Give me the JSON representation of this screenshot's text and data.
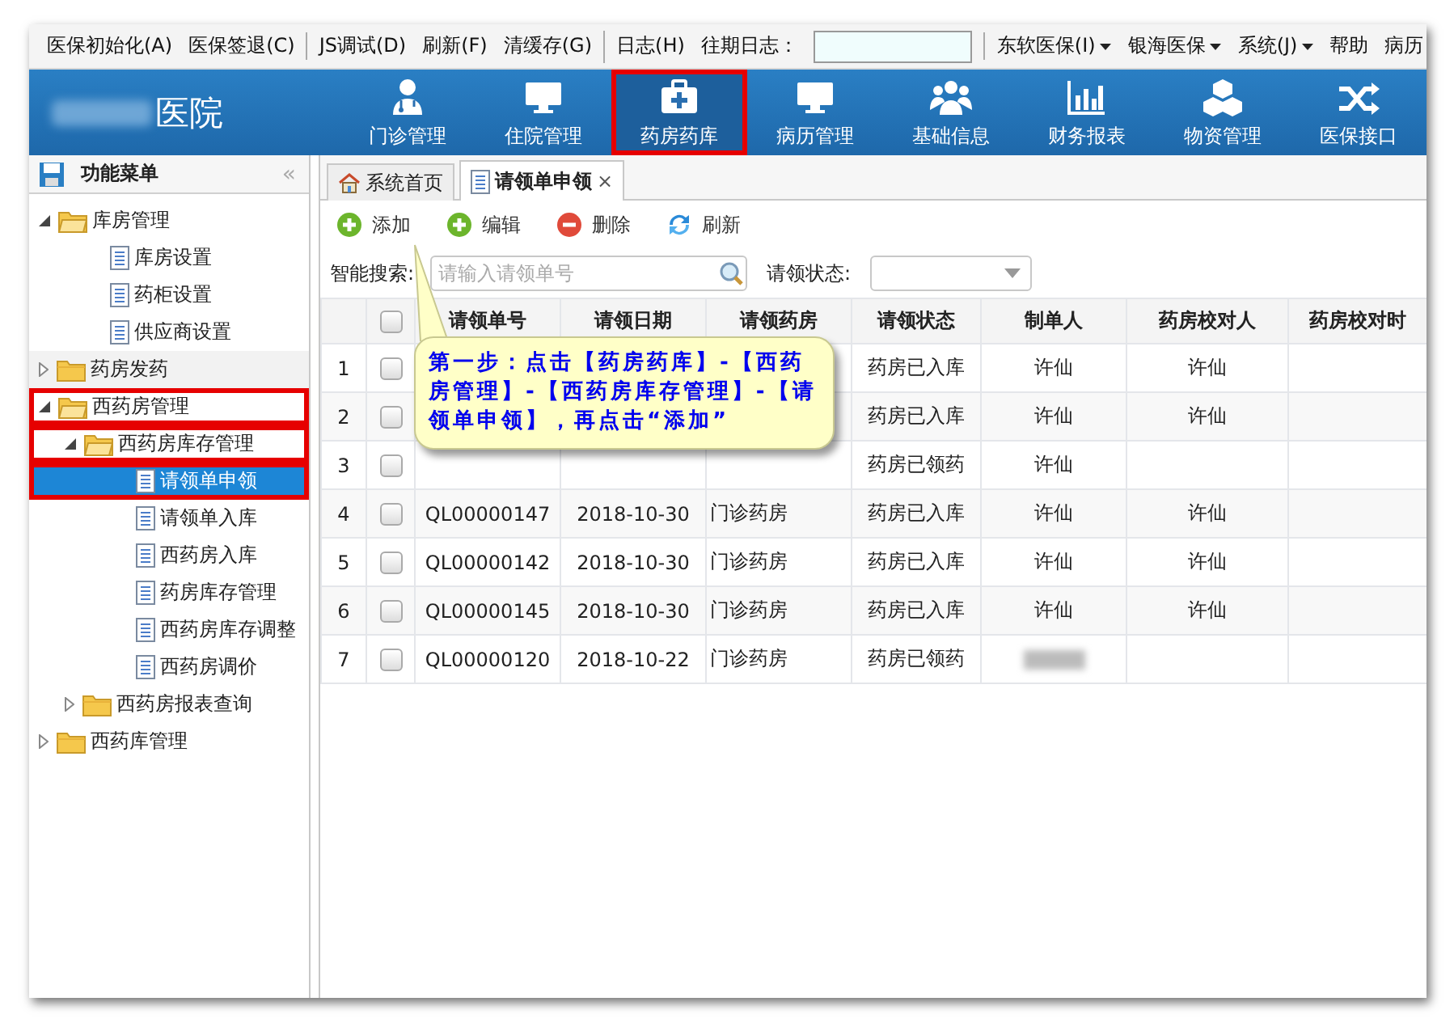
{
  "menu_bar": {
    "groups": [
      [
        {
          "label": "医保初始化(A)"
        },
        {
          "label": "医保签退(C)"
        }
      ],
      [
        {
          "label": "JS调试(D)"
        },
        {
          "label": "刷新(F)"
        },
        {
          "label": "清缓存(G)"
        }
      ],
      [
        {
          "label": "日志(H)"
        },
        {
          "label": "往期日志：",
          "kind": "field"
        }
      ],
      [
        {
          "label": "东软医保(I)",
          "dropdown": true
        },
        {
          "label": "银海医保",
          "dropdown": true
        },
        {
          "label": "系统(J)",
          "dropdown": true
        },
        {
          "label": "帮助"
        },
        {
          "label": "病历"
        }
      ]
    ]
  },
  "header": {
    "logo_text": "医院",
    "logo_redacted": true,
    "nav": [
      {
        "label": "门诊管理",
        "highlighted": false
      },
      {
        "label": "住院管理",
        "highlighted": false
      },
      {
        "label": "药房药库",
        "highlighted": true
      },
      {
        "label": "病历管理",
        "highlighted": false
      },
      {
        "label": "基础信息",
        "highlighted": false
      },
      {
        "label": "财务报表",
        "highlighted": false
      },
      {
        "label": "物资管理",
        "highlighted": false
      },
      {
        "label": "医保接口",
        "highlighted": false
      }
    ]
  },
  "sidebar": {
    "title": "功能菜单",
    "collapse": "«",
    "items": [
      {
        "label": "库房管理",
        "expanded": true,
        "selected": false,
        "highlighted": false,
        "children": [
          {
            "label": "库房设置",
            "selected": false,
            "highlighted": false
          },
          {
            "label": "药柜设置",
            "selected": false,
            "highlighted": false
          },
          {
            "label": "供应商设置",
            "selected": false,
            "highlighted": false
          }
        ]
      },
      {
        "label": "药房发药",
        "expanded": false,
        "selected": false,
        "highlighted": false
      },
      {
        "label": "西药房管理",
        "expanded": true,
        "selected": false,
        "highlighted": true,
        "children": [
          {
            "label": "西药房库存管理",
            "expanded": true,
            "selected": false,
            "highlighted": true,
            "children": [
              {
                "label": "请领单申领",
                "selected": true,
                "highlighted": true
              },
              {
                "label": "请领单入库",
                "selected": false,
                "highlighted": false
              },
              {
                "label": "西药房入库",
                "selected": false,
                "highlighted": false
              },
              {
                "label": "药房库存管理",
                "selected": false,
                "highlighted": false
              },
              {
                "label": "西药房库存调整",
                "selected": false,
                "highlighted": false
              },
              {
                "label": "西药房调价",
                "selected": false,
                "highlighted": false
              }
            ]
          },
          {
            "label": "西药房报表查询",
            "expanded": false,
            "selected": false,
            "highlighted": false
          }
        ]
      },
      {
        "label": "西药库管理",
        "expanded": false,
        "selected": false,
        "highlighted": false
      }
    ]
  },
  "tabs": [
    {
      "label": "系统首页",
      "selected": false
    },
    {
      "label": "请领单申领",
      "selected": true,
      "close": "×"
    }
  ],
  "toolbar": [
    {
      "label": "添加"
    },
    {
      "label": "编辑"
    },
    {
      "label": "删除"
    },
    {
      "label": "刷新"
    }
  ],
  "search": {
    "label": "智能搜索:",
    "placeholder": "请输入请领单号",
    "status_label": "请领状态:"
  },
  "table": {
    "select_all_checked": false,
    "columns": [
      "请领单号",
      "请领日期",
      "请领药房",
      "请领状态",
      "制单人",
      "药房校对人",
      "药房校对时"
    ],
    "rows": [
      {
        "n": "1",
        "checked": false,
        "status": "药房已入库",
        "maker": "许仙",
        "checker": "许仙"
      },
      {
        "n": "2",
        "checked": false,
        "status": "药房已入库",
        "maker": "许仙",
        "checker": "许仙"
      },
      {
        "n": "3",
        "checked": false,
        "status": "药房已领药",
        "maker": "许仙"
      },
      {
        "n": "4",
        "checked": false,
        "id": "QL00000147",
        "date": "2018-10-30",
        "pharmacy": "门诊药房",
        "status": "药房已入库",
        "maker": "许仙",
        "checker": "许仙"
      },
      {
        "n": "5",
        "checked": false,
        "id": "QL00000142",
        "date": "2018-10-30",
        "pharmacy": "门诊药房",
        "status": "药房已入库",
        "maker": "许仙",
        "checker": "许仙"
      },
      {
        "n": "6",
        "checked": false,
        "id": "QL00000145",
        "date": "2018-10-30",
        "pharmacy": "门诊药房",
        "status": "药房已入库",
        "maker": "许仙",
        "checker": "许仙"
      },
      {
        "n": "7",
        "checked": false,
        "id": "QL00000120",
        "date": "2018-10-22",
        "pharmacy": "门诊药房",
        "status": "药房已领药",
        "maker_redacted": true
      }
    ]
  },
  "callout": {
    "text": "第一步：点击【药房药库】-【西药房管理】-【西药房库存管理】-【请领单申领】，再点击“添加”"
  }
}
